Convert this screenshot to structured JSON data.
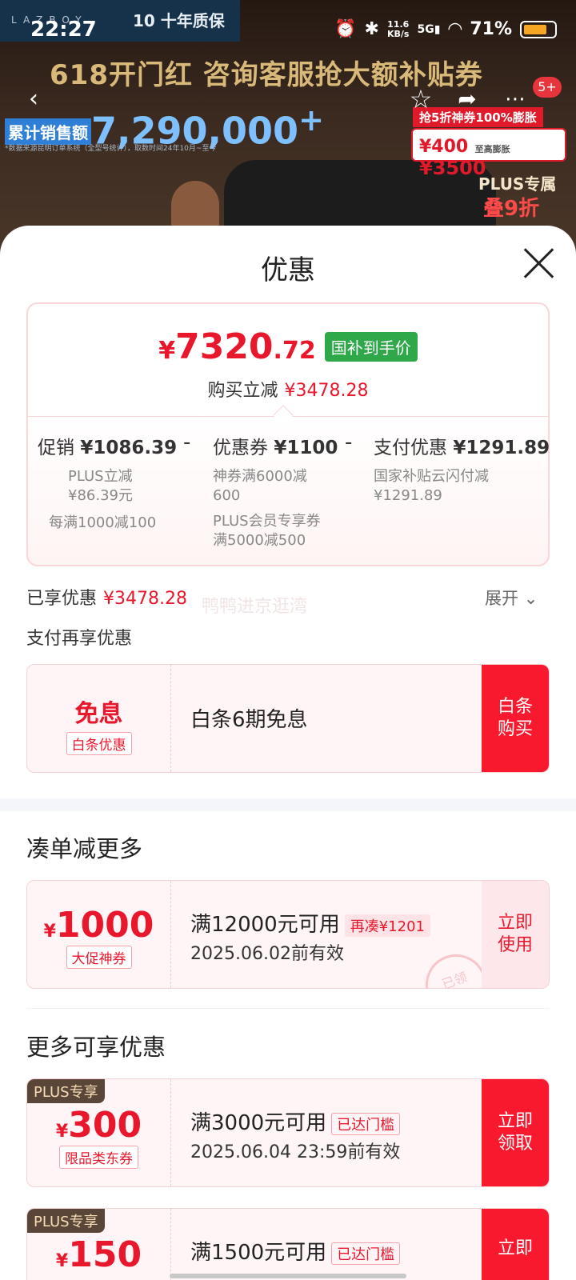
{
  "status_bar": {
    "time": "22:27",
    "net_speed": "11.6",
    "net_unit": "KB/s",
    "signal": "5G",
    "battery": "71%"
  },
  "banner": {
    "brand_logo": "LAZBOY",
    "brand_badge": "10 十年质保",
    "slogan": "618开门红 咨询客服抢大额补贴券",
    "sales_label": "累计销售额",
    "sales_value": "7,290,000",
    "sales_plus": "+",
    "sales_note": "*数据来源昆明订单系统（全型号统计），取数时间24年10月~至今",
    "promo_tag": "抢5折神券100%膨胀",
    "subsidy_from": "¥400",
    "subsidy_mid": "至高膨胀",
    "subsidy_to": "¥3500",
    "plus_label": "PLUS专属",
    "plus_discount": "叠9折",
    "badge_count": "5+"
  },
  "sheet": {
    "title": "优惠",
    "price": {
      "currency": "¥",
      "integer": "7320",
      "decimal": ".72",
      "tag": "国补到手价"
    },
    "save": {
      "label": "购买立减",
      "value": "¥3478.28"
    },
    "cols": [
      {
        "label": "促销",
        "value": "¥1086.39",
        "sub1": "PLUS立减",
        "sub2": "¥86.39元",
        "sub3": "每满1000减100"
      },
      {
        "label": "优惠券",
        "value": "¥1100",
        "sub1": "神券满6000减",
        "sub2": "600",
        "sub3": "PLUS会员专享券",
        "sub4": "满5000减500"
      },
      {
        "label": "支付优惠",
        "value": "¥1291.89",
        "sub1": "国家补贴云闪付减",
        "sub2": "¥1291.89"
      }
    ],
    "minus_sign": "-",
    "enjoyed": {
      "label": "已享优惠",
      "value": "¥3478.28",
      "expand": "展开"
    },
    "watermark": "鸭鸭进京逛湾",
    "pay_more": "支付再享优惠",
    "baitiao": {
      "big": "免息",
      "tag": "白条优惠",
      "desc": "白条6期免息",
      "cta1": "白条",
      "cta2": "购买"
    },
    "section_more": "凑单减更多",
    "coupon_1000": {
      "currency": "¥",
      "amount": "1000",
      "tag": "大促神券",
      "cond": "满12000元可用",
      "extra": "再凑¥1201",
      "valid": "2025.06.02前有效",
      "cta1": "立即",
      "cta2": "使用",
      "stamp": "已领"
    },
    "section_avail": "更多可享优惠",
    "coupon_300": {
      "badge": "PLUS专享",
      "currency": "¥",
      "amount": "300",
      "tag": "限品类东券",
      "cond": "满3000元可用",
      "extra": "已达门槛",
      "valid": "2025.06.04 23:59前有效",
      "cta1": "立即",
      "cta2": "领取"
    },
    "coupon_150": {
      "badge": "PLUS专享",
      "currency": "¥",
      "amount": "150",
      "cond": "满1500元可用",
      "extra": "已达门槛",
      "cta1": "立即"
    }
  }
}
